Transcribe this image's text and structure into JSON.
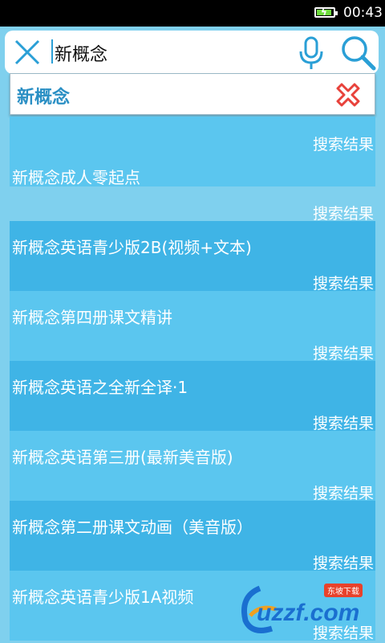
{
  "status_bar": {
    "time": "00:43"
  },
  "search": {
    "query": "新概念"
  },
  "suggestion": {
    "text": "新概念"
  },
  "results": {
    "tag_label": "搜索结果",
    "items": [
      {
        "title": ""
      },
      {
        "title": "新概念成人零起点"
      },
      {
        "title": "新概念英语青少版2B(视频+文本)"
      },
      {
        "title": "新概念第四册课文精讲"
      },
      {
        "title": "新概念英语之全新全译·1"
      },
      {
        "title": "新概念英语第三册(最新美音版)"
      },
      {
        "title": "新概念第二册课文动画（美音版）"
      },
      {
        "title": "新概念英语青少版1A视频"
      }
    ]
  },
  "watermark": {
    "text": "uzzf.com",
    "sub": "东坡下载"
  },
  "colors": {
    "accent": "#2a9fd6",
    "row_light": "#5bc6ef",
    "row_dark": "#3fb4e6",
    "delete": "#e8423b"
  }
}
